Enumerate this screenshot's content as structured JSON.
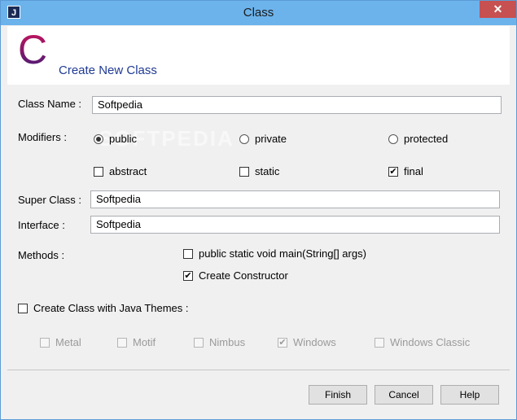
{
  "window": {
    "title": "Class",
    "app_icon": "J",
    "close_glyph": "✕"
  },
  "header": {
    "logo_letter": "C",
    "title": "Create New Class"
  },
  "form": {
    "class_name_label": "Class Name :",
    "class_name_value": "Softpedia",
    "modifiers_label": "Modifiers :",
    "access": [
      {
        "label": "public",
        "selected": true
      },
      {
        "label": "private",
        "selected": false
      },
      {
        "label": "protected",
        "selected": false
      }
    ],
    "flags": [
      {
        "label": "abstract",
        "checked": false
      },
      {
        "label": "static",
        "checked": false
      },
      {
        "label": "final",
        "checked": true
      }
    ],
    "super_class_label": "Super Class :",
    "super_class_value": "Softpedia",
    "interface_label": "Interface :",
    "interface_value": "Softpedia",
    "methods_label": "Methods :",
    "methods": [
      {
        "label": "public static void main(String[] args)",
        "checked": false
      },
      {
        "label": "Create Constructor",
        "checked": true
      }
    ],
    "themes_label": "Create Class with Java Themes :",
    "themes_checked": false,
    "themes": [
      {
        "label": "Metal",
        "checked": false
      },
      {
        "label": "Motif",
        "checked": false
      },
      {
        "label": "Nimbus",
        "checked": false
      },
      {
        "label": "Windows",
        "checked": true
      },
      {
        "label": "Windows Classic",
        "checked": false
      }
    ]
  },
  "buttons": {
    "finish": "Finish",
    "cancel": "Cancel",
    "help": "Help"
  },
  "watermark": "SOFTPEDIA",
  "colors": {
    "titlebar": "#6cb3ec",
    "close": "#c75050",
    "header_title": "#1f3a93",
    "logo_top": "#d4145a",
    "logo_bottom": "#3b1c7a"
  }
}
